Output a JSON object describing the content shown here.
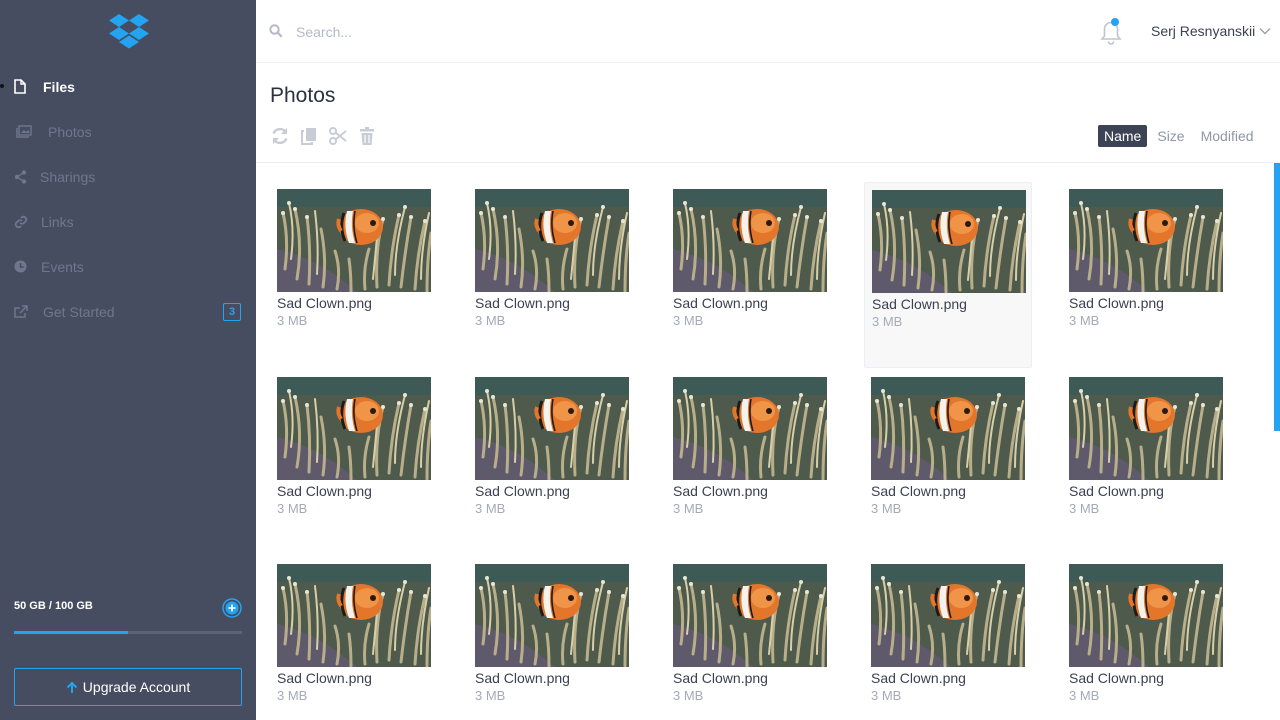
{
  "brand": {
    "name": "Dropbox",
    "accent": "#23a3f0",
    "sidebar_bg": "#474d60"
  },
  "sidebar": {
    "items": [
      {
        "label": "Files",
        "icon": "file-icon",
        "active": true
      },
      {
        "label": "Photos",
        "icon": "photos-icon",
        "active": false
      },
      {
        "label": "Sharings",
        "icon": "share-icon",
        "active": false
      },
      {
        "label": "Links",
        "icon": "link-icon",
        "active": false
      },
      {
        "label": "Events",
        "icon": "clock-icon",
        "active": false
      },
      {
        "label": "Get Started",
        "icon": "external-link-icon",
        "active": false,
        "badge": "3"
      }
    ],
    "storage": {
      "label": "50 GB / 100 GB",
      "used_gb": 50,
      "total_gb": 100,
      "fraction": 0.5
    },
    "upgrade_label": "Upgrade Account"
  },
  "header": {
    "search_placeholder": "Search...",
    "user_name": "Serj Resnyanskii",
    "has_notifications": true
  },
  "main": {
    "title": "Photos",
    "toolbar": [
      "refresh-icon",
      "copy-icon",
      "cut-icon",
      "trash-icon"
    ],
    "sort": {
      "options": [
        "Name",
        "Size",
        "Modified"
      ],
      "selected": "Name"
    },
    "files": [
      {
        "name": "Sad Clown.png",
        "size": "3 MB"
      },
      {
        "name": "Sad Clown.png",
        "size": "3 MB"
      },
      {
        "name": "Sad Clown.png",
        "size": "3 MB"
      },
      {
        "name": "Sad Clown.png",
        "size": "3 MB",
        "hovered": true
      },
      {
        "name": "Sad Clown.png",
        "size": "3 MB"
      },
      {
        "name": "Sad Clown.png",
        "size": "3 MB"
      },
      {
        "name": "Sad Clown.png",
        "size": "3 MB"
      },
      {
        "name": "Sad Clown.png",
        "size": "3 MB"
      },
      {
        "name": "Sad Clown.png",
        "size": "3 MB"
      },
      {
        "name": "Sad Clown.png",
        "size": "3 MB"
      },
      {
        "name": "Sad Clown.png",
        "size": "3 MB"
      },
      {
        "name": "Sad Clown.png",
        "size": "3 MB"
      },
      {
        "name": "Sad Clown.png",
        "size": "3 MB"
      },
      {
        "name": "Sad Clown.png",
        "size": "3 MB"
      },
      {
        "name": "Sad Clown.png",
        "size": "3 MB"
      }
    ]
  }
}
